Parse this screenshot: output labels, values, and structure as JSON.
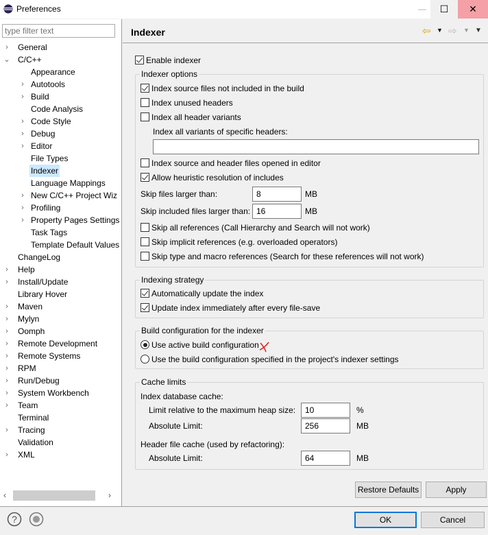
{
  "window": {
    "title": "Preferences",
    "minimize": "—",
    "maximize": "☐",
    "close": "✕"
  },
  "sidebar": {
    "filter_placeholder": "type filter text",
    "items": [
      {
        "label": "General",
        "level": 0,
        "expander": "collapsed"
      },
      {
        "label": "C/C++",
        "level": 0,
        "expander": "expanded"
      },
      {
        "label": "Appearance",
        "level": 1,
        "expander": "none"
      },
      {
        "label": "Autotools",
        "level": 1,
        "expander": "collapsed"
      },
      {
        "label": "Build",
        "level": 1,
        "expander": "collapsed"
      },
      {
        "label": "Code Analysis",
        "level": 1,
        "expander": "none"
      },
      {
        "label": "Code Style",
        "level": 1,
        "expander": "collapsed"
      },
      {
        "label": "Debug",
        "level": 1,
        "expander": "collapsed"
      },
      {
        "label": "Editor",
        "level": 1,
        "expander": "collapsed"
      },
      {
        "label": "File Types",
        "level": 1,
        "expander": "none"
      },
      {
        "label": "Indexer",
        "level": 1,
        "expander": "none",
        "selected": true
      },
      {
        "label": "Language Mappings",
        "level": 1,
        "expander": "none"
      },
      {
        "label": "New C/C++ Project Wiz",
        "level": 1,
        "expander": "collapsed"
      },
      {
        "label": "Profiling",
        "level": 1,
        "expander": "collapsed"
      },
      {
        "label": "Property Pages Settings",
        "level": 1,
        "expander": "collapsed"
      },
      {
        "label": "Task Tags",
        "level": 1,
        "expander": "none"
      },
      {
        "label": "Template Default Values",
        "level": 1,
        "expander": "none"
      },
      {
        "label": "ChangeLog",
        "level": 0,
        "expander": "none"
      },
      {
        "label": "Help",
        "level": 0,
        "expander": "collapsed"
      },
      {
        "label": "Install/Update",
        "level": 0,
        "expander": "collapsed"
      },
      {
        "label": "Library Hover",
        "level": 0,
        "expander": "none"
      },
      {
        "label": "Maven",
        "level": 0,
        "expander": "collapsed"
      },
      {
        "label": "Mylyn",
        "level": 0,
        "expander": "collapsed"
      },
      {
        "label": "Oomph",
        "level": 0,
        "expander": "collapsed"
      },
      {
        "label": "Remote Development",
        "level": 0,
        "expander": "collapsed"
      },
      {
        "label": "Remote Systems",
        "level": 0,
        "expander": "collapsed"
      },
      {
        "label": "RPM",
        "level": 0,
        "expander": "collapsed"
      },
      {
        "label": "Run/Debug",
        "level": 0,
        "expander": "collapsed"
      },
      {
        "label": "System Workbench",
        "level": 0,
        "expander": "collapsed"
      },
      {
        "label": "Team",
        "level": 0,
        "expander": "collapsed"
      },
      {
        "label": "Terminal",
        "level": 0,
        "expander": "none"
      },
      {
        "label": "Tracing",
        "level": 0,
        "expander": "collapsed"
      },
      {
        "label": "Validation",
        "level": 0,
        "expander": "none"
      },
      {
        "label": "XML",
        "level": 0,
        "expander": "collapsed"
      }
    ]
  },
  "page": {
    "title": "Indexer",
    "enable_indexer": {
      "label": "Enable indexer",
      "checked": true
    },
    "indexer_options": {
      "legend": "Indexer options",
      "index_source_not_in_build": {
        "label": "Index source files not included in the build",
        "checked": true
      },
      "index_unused_headers": {
        "label": "Index unused headers",
        "checked": false
      },
      "index_all_header_variants": {
        "label": "Index all header variants",
        "checked": false
      },
      "specific_headers_label": "Index all variants of specific headers:",
      "specific_headers_value": "",
      "index_opened_in_editor": {
        "label": "Index source and header files opened in editor",
        "checked": false
      },
      "heuristic_includes": {
        "label": "Allow heuristic resolution of includes",
        "checked": true
      },
      "skip_larger_label": "Skip files larger than:",
      "skip_larger_value": "8",
      "skip_larger_unit": "MB",
      "skip_included_label": "Skip included files larger than:",
      "skip_included_value": "16",
      "skip_included_unit": "MB",
      "skip_all_refs": {
        "label": "Skip all references (Call Hierarchy and Search will not work)",
        "checked": false
      },
      "skip_implicit_refs": {
        "label": "Skip implicit references (e.g. overloaded operators)",
        "checked": false
      },
      "skip_type_macro_refs": {
        "label": "Skip type and macro references (Search for these references will not work)",
        "checked": false
      }
    },
    "strategy": {
      "legend": "Indexing strategy",
      "auto_update": {
        "label": "Automatically update the index",
        "checked": true
      },
      "update_on_save": {
        "label": "Update index immediately after every file-save",
        "checked": true
      }
    },
    "build_config": {
      "legend": "Build configuration for the indexer",
      "use_active": {
        "label": "Use active build configuration",
        "selected": true
      },
      "use_specified": {
        "label": "Use the build configuration specified in the project's indexer settings",
        "selected": false
      }
    },
    "cache": {
      "legend": "Cache limits",
      "db_cache_label": "Index database cache:",
      "relative_label": "Limit relative to the maximum heap size:",
      "relative_value": "10",
      "relative_unit": "%",
      "absolute_label": "Absolute Limit:",
      "absolute_value": "256",
      "absolute_unit": "MB",
      "header_cache_label": "Header file cache (used by refactoring):",
      "header_absolute_label": "Absolute Limit:",
      "header_absolute_value": "64",
      "header_absolute_unit": "MB"
    },
    "restore_defaults": "Restore Defaults",
    "apply": "Apply"
  },
  "footer": {
    "ok": "OK",
    "cancel": "Cancel"
  },
  "colors": {
    "selection": "#cce8ff",
    "close_hover": "#f4a0a6",
    "ok_border": "#0078d7",
    "annotation": "#e02020"
  }
}
